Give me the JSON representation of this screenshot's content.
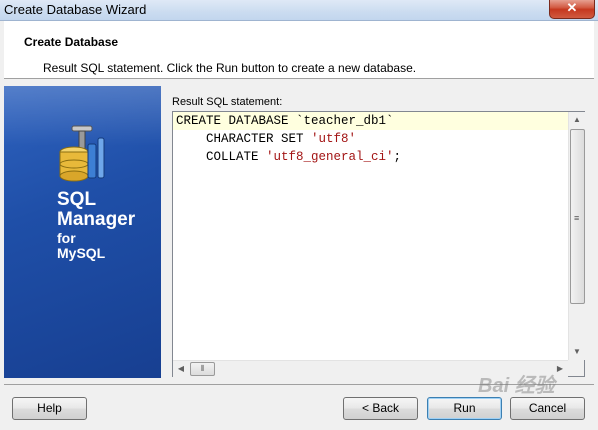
{
  "window": {
    "title": "Create Database Wizard",
    "close_label": "✕"
  },
  "header": {
    "title": "Create Database",
    "description": "Result SQL statement. Click the Run  button to create a new database."
  },
  "branding": {
    "line1": "SQL",
    "line2": "Manager",
    "line3": "for",
    "line4": "MySQL"
  },
  "content": {
    "label": "Result SQL statement:",
    "code_lines": [
      {
        "parts": [
          {
            "t": "CREATE DATABASE `teacher_db1`",
            "c": "kw"
          }
        ]
      },
      {
        "parts": [
          {
            "t": "    CHARACTER SET ",
            "c": "kw"
          },
          {
            "t": "'utf8'",
            "c": "str"
          }
        ]
      },
      {
        "parts": [
          {
            "t": "    COLLATE ",
            "c": "kw"
          },
          {
            "t": "'utf8_general_ci'",
            "c": "str"
          },
          {
            "t": ";",
            "c": "kw"
          }
        ]
      }
    ]
  },
  "buttons": {
    "help": "Help",
    "back": "< Back",
    "run": "Run",
    "cancel": "Cancel"
  },
  "watermark": "Bai 经验",
  "colors": {
    "panel_blue": "#1f4fa8",
    "string_red": "#a31515",
    "current_line": "#ffffdf"
  }
}
